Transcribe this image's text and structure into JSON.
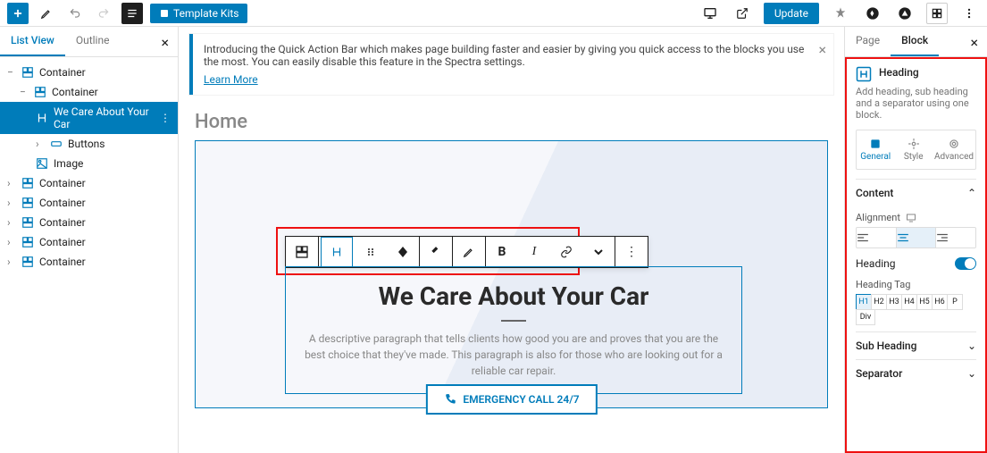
{
  "topbar": {
    "template_kits": "Template Kits",
    "update": "Update"
  },
  "sidebar_left": {
    "tabs": {
      "list_view": "List View",
      "outline": "Outline"
    },
    "items": [
      {
        "label": "Container"
      },
      {
        "label": "Container"
      },
      {
        "label": "We Care About Your Car"
      },
      {
        "label": "Buttons"
      },
      {
        "label": "Image"
      },
      {
        "label": "Container"
      },
      {
        "label": "Container"
      },
      {
        "label": "Container"
      },
      {
        "label": "Container"
      },
      {
        "label": "Container"
      }
    ]
  },
  "notice": {
    "text": "Introducing the Quick Action Bar which makes page building faster and easier by giving you quick access to the blocks you use the most. You can easily disable this feature in the Spectra settings.",
    "link": "Learn More"
  },
  "page_title": "Home",
  "heading_block": {
    "title": "We Care About Your Car",
    "desc": "A descriptive paragraph that tells clients how good you are and proves that you are the best choice that they've made. This paragraph is also for those who are looking out for a reliable car repair."
  },
  "cta": "EMERGENCY CALL 24/7",
  "sidebar_right": {
    "tabs": {
      "page": "Page",
      "block": "Block"
    },
    "block_name": "Heading",
    "block_desc": "Add heading, sub heading and a separator using one block.",
    "subtabs": {
      "general": "General",
      "style": "Style",
      "advanced": "Advanced"
    },
    "panels": {
      "content": "Content",
      "alignment": "Alignment",
      "heading": "Heading",
      "heading_tag": "Heading Tag",
      "sub_heading": "Sub Heading",
      "separator": "Separator"
    },
    "tags": [
      "H1",
      "H2",
      "H3",
      "H4",
      "H5",
      "H6",
      "P",
      "Div"
    ]
  }
}
